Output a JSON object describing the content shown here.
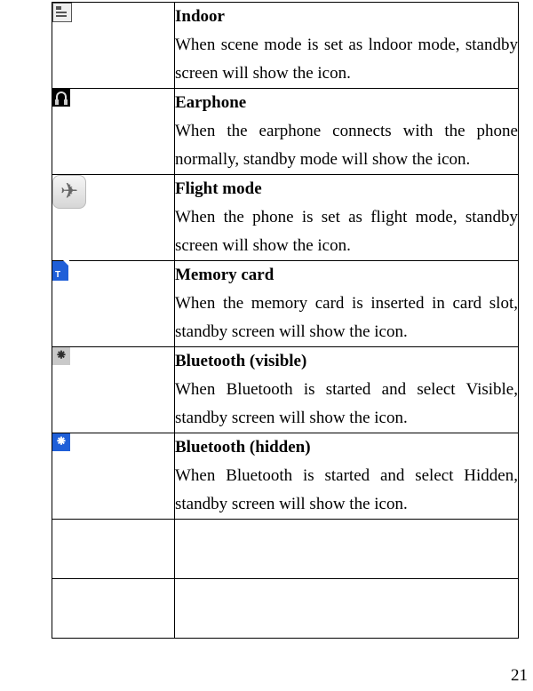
{
  "page_number": "21",
  "rows": [
    {
      "icon": "indoor-icon",
      "title": "Indoor",
      "body": "When scene mode is set as lndoor mode, standby screen will show the icon."
    },
    {
      "icon": "earphone-icon",
      "title": "Earphone",
      "body": "When the earphone connects with the phone normally, standby mode will show the icon."
    },
    {
      "icon": "flight-mode-icon",
      "title": "Flight mode",
      "body": "When the phone is set as flight mode, standby screen will show the icon."
    },
    {
      "icon": "memory-card-icon",
      "title": "Memory card",
      "body": "When the memory card is inserted in card slot, standby screen will show the icon."
    },
    {
      "icon": "bluetooth-visible-icon",
      "title": "Bluetooth (visible)",
      "body": "When Bluetooth is started and select Visible, standby screen will show the icon."
    },
    {
      "icon": "bluetooth-hidden-icon",
      "title": "Bluetooth (hidden)",
      "body": "When Bluetooth is started and select Hidden, standby screen will show the icon."
    },
    {
      "icon": "",
      "title": "",
      "body": ""
    },
    {
      "icon": "",
      "title": "",
      "body": ""
    }
  ],
  "glyphs": {
    "flight": "✈",
    "bt": "⁕"
  }
}
